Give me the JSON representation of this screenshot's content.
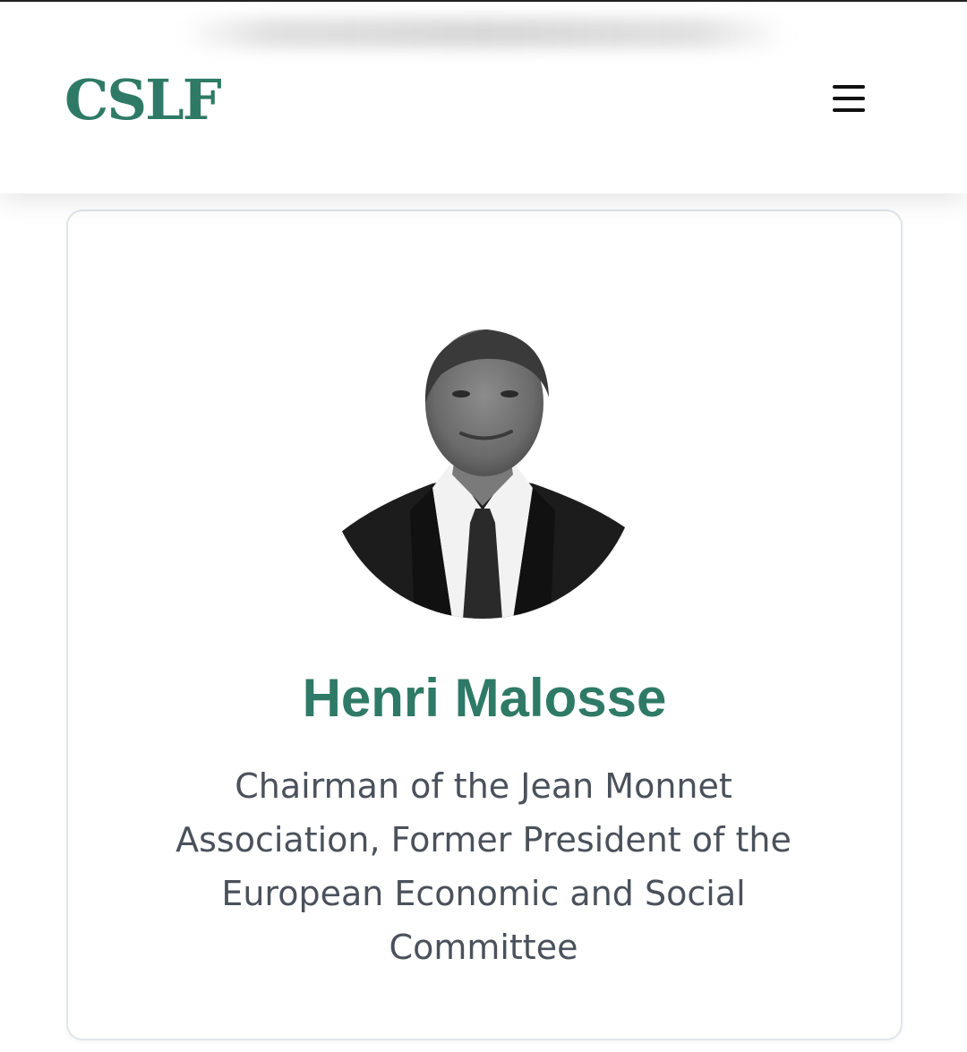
{
  "header": {
    "logo_text": "CSLF",
    "menu_icon": "hamburger-menu-icon"
  },
  "profile": {
    "name": "Henri Malosse",
    "role": "Chairman of the Jean Monnet Association, Former President of the European Economic and Social Committee"
  },
  "colors": {
    "brand_green": "#2e7a66",
    "text_gray": "#4b515b",
    "card_border": "#e1e4ea"
  }
}
